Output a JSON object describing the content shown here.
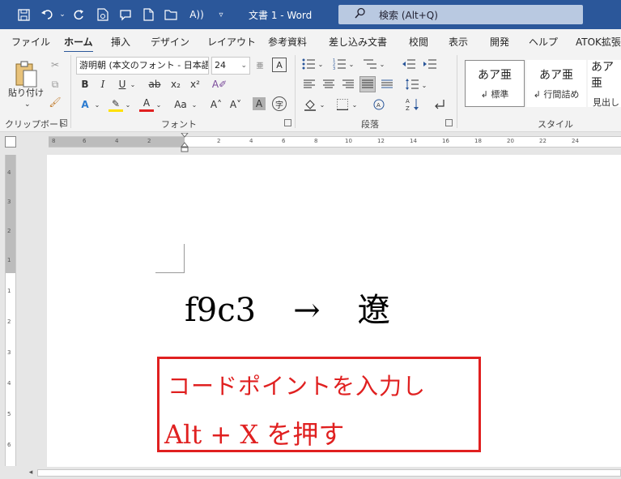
{
  "titlebar": {
    "doc_title": "文書 1  -  Word",
    "search_placeholder": "検索 (Alt+Q)",
    "qat": {
      "save_icon": "💾",
      "undo_icon": "↶",
      "redo_icon": "↻",
      "dropdown": "▿"
    }
  },
  "tabs": [
    "ファイル",
    "ホーム",
    "挿入",
    "デザイン",
    "レイアウト",
    "参考資料",
    "差し込み文書",
    "校閲",
    "表示",
    "開発",
    "ヘルプ",
    "ATOK拡張"
  ],
  "active_tab": "ホーム",
  "ribbon": {
    "clipboard": {
      "label": "クリップボード",
      "paste_label": "貼り付け"
    },
    "font": {
      "label": "フォント",
      "font_name": "游明朝 (本文のフォント - 日本語)",
      "font_size": "24",
      "bold": "B",
      "italic": "I",
      "underline": "U",
      "strike": "ab",
      "subscript": "x₂",
      "superscript": "x²",
      "text_effect": "A",
      "highlight": "✎",
      "font_color": "A",
      "change_case": "Aa",
      "grow": "A˄",
      "shrink": "A˅",
      "char_shading": "A",
      "enclose": "字"
    },
    "paragraph": {
      "label": "段落"
    },
    "styles": {
      "label": "スタイル",
      "items": [
        {
          "sample": "あア亜",
          "name": "↲ 標準"
        },
        {
          "sample": "あア亜",
          "name": "↲ 行間詰め"
        },
        {
          "sample": "あア亜",
          "name": "見出し"
        }
      ]
    }
  },
  "document": {
    "line1": {
      "code": "f9c3",
      "arrow": "→",
      "char": "遼"
    },
    "annotation": {
      "line1": "コードポイントを入力し",
      "line2": "Alt + X を押す"
    }
  },
  "ruler": {
    "h_ticks": [
      "8",
      "6",
      "4",
      "2",
      "2",
      "4",
      "6",
      "8",
      "10",
      "12",
      "14",
      "16",
      "18",
      "20",
      "22",
      "24"
    ],
    "v_ticks": [
      "4",
      "3",
      "2",
      "1",
      "1",
      "2",
      "3",
      "4",
      "5",
      "6"
    ]
  },
  "colors": {
    "title_bar": "#2b579a",
    "annotation_red": "#e02020"
  }
}
